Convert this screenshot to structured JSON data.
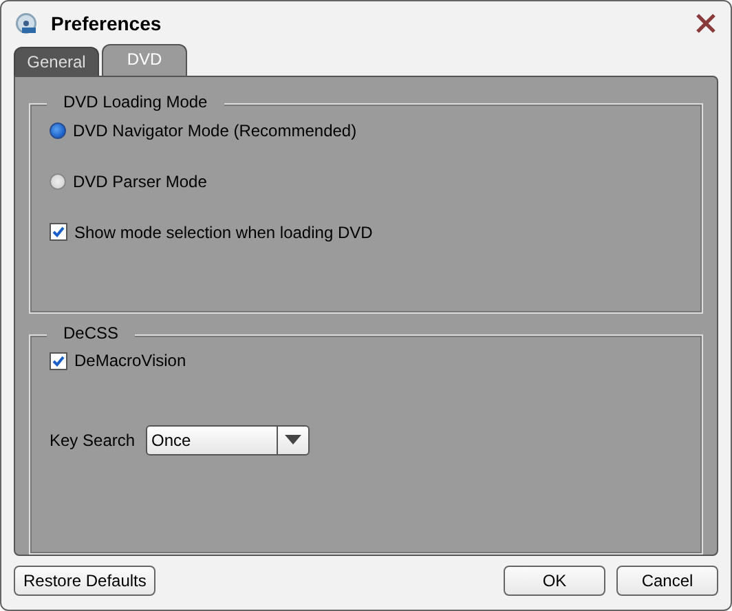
{
  "window": {
    "title": "Preferences"
  },
  "tabs": [
    {
      "label": "General",
      "selected": false
    },
    {
      "label": "DVD",
      "selected": true
    }
  ],
  "groups": [
    {
      "title": "DVD Loading Mode",
      "items": [
        {
          "kind": "radio",
          "label": "DVD Navigator Mode (Recommended)",
          "selected": true
        },
        {
          "kind": "radio",
          "label": "DVD Parser Mode",
          "selected": false
        },
        {
          "kind": "checkbox",
          "label": "Show mode selection when loading DVD",
          "checked": true
        }
      ]
    },
    {
      "title": "DeCSS",
      "items": [
        {
          "kind": "checkbox",
          "label": "DeMacroVision",
          "checked": true
        },
        {
          "kind": "select",
          "label": "Key Search",
          "value": "Once"
        }
      ]
    }
  ],
  "buttons": {
    "left": [
      "Restore Defaults"
    ],
    "right": [
      "OK",
      "Cancel"
    ]
  }
}
